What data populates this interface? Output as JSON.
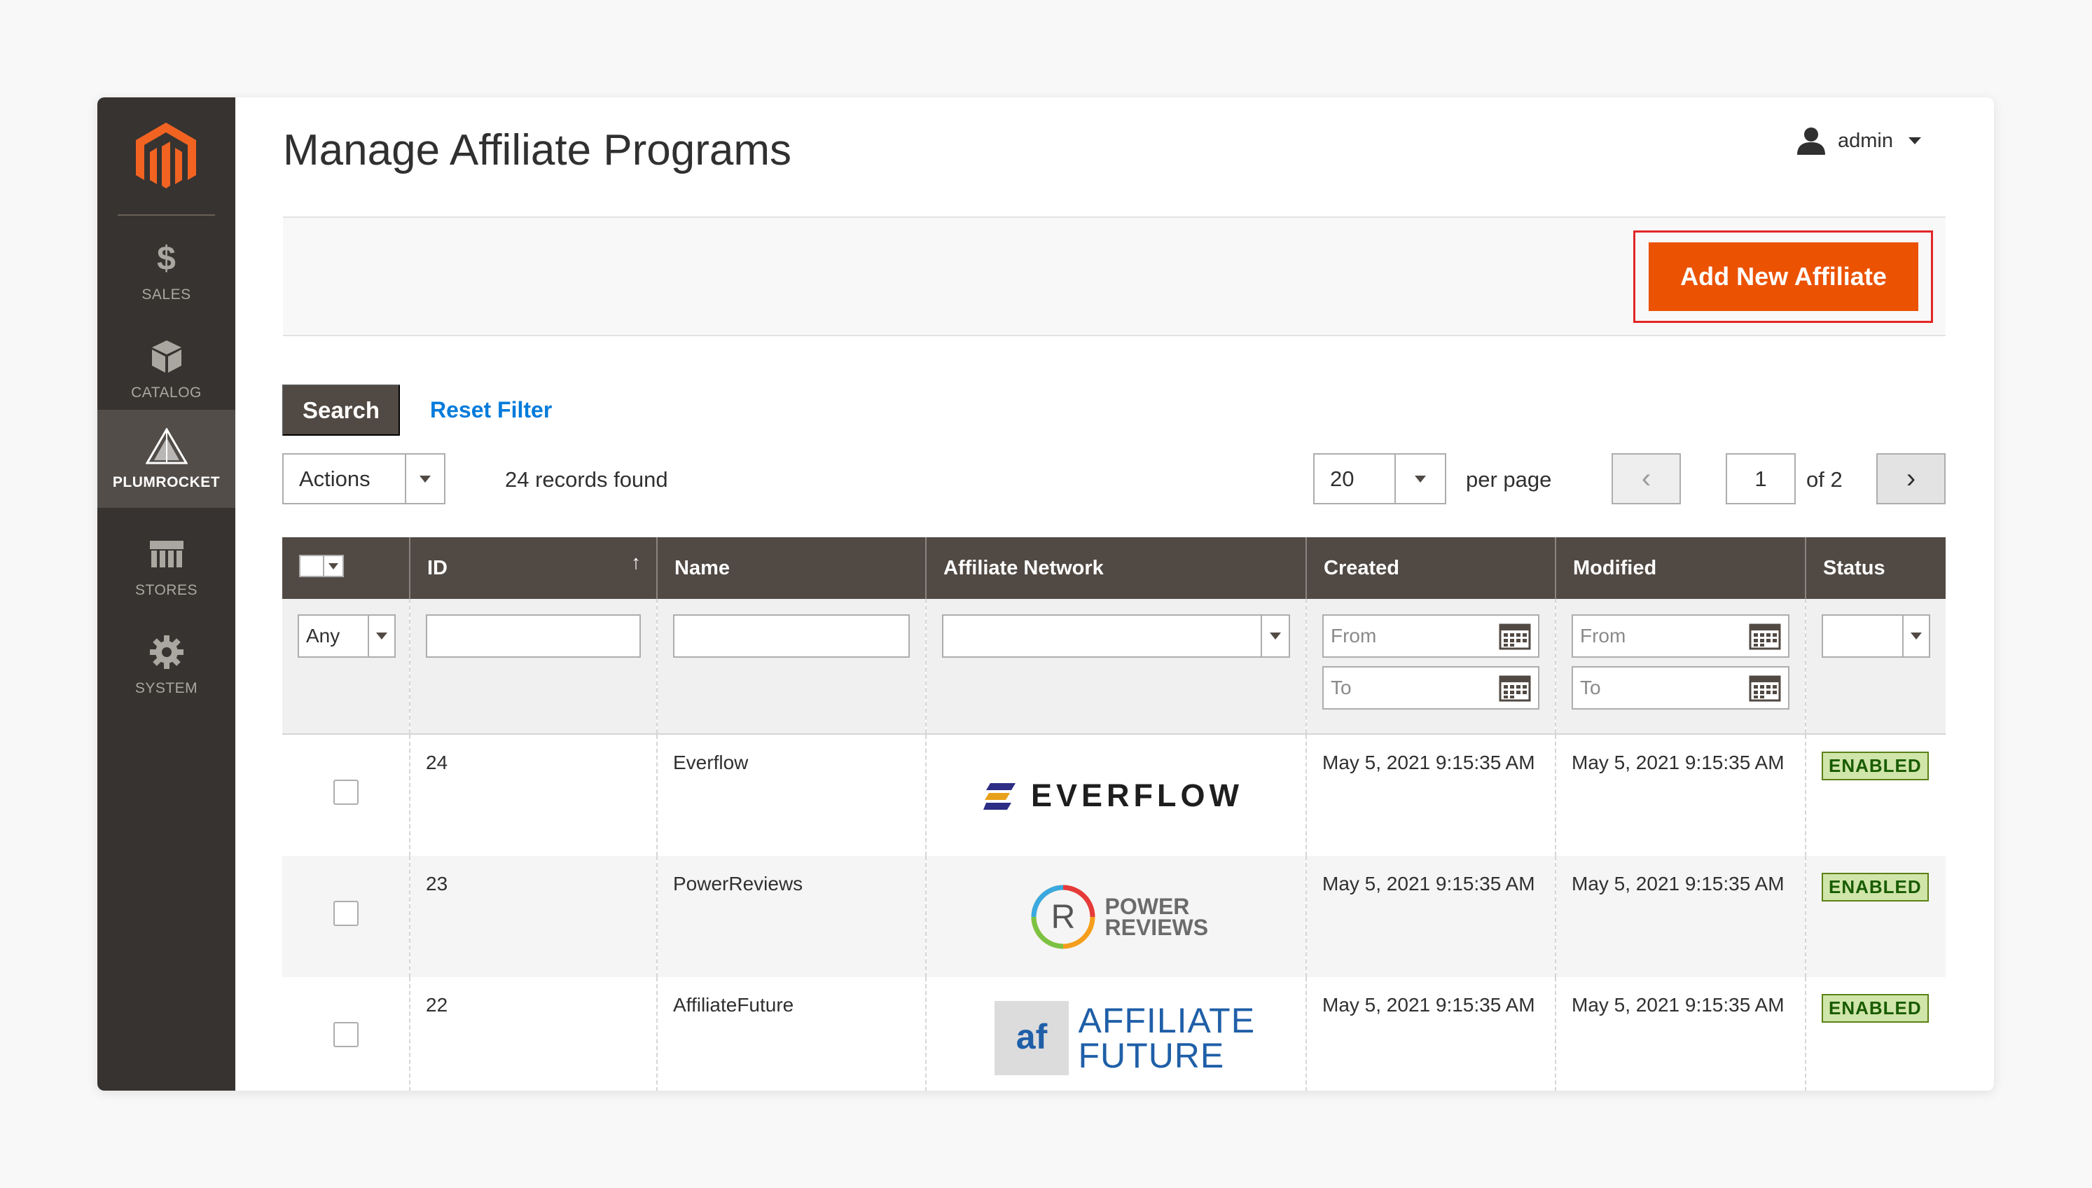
{
  "sidebar": {
    "items": [
      {
        "label": "SALES",
        "icon": "dollar-icon"
      },
      {
        "label": "CATALOG",
        "icon": "box-icon"
      },
      {
        "label": "PLUMROCKET",
        "icon": "plumrocket-icon",
        "active": true
      },
      {
        "label": "STORES",
        "icon": "store-icon"
      },
      {
        "label": "SYSTEM",
        "icon": "gear-icon"
      }
    ]
  },
  "header": {
    "title": "Manage Affiliate Programs",
    "user": "admin"
  },
  "toolbar": {
    "add_label": "Add New Affiliate",
    "search_label": "Search",
    "reset_label": "Reset Filter",
    "actions_label": "Actions",
    "records_text": "24 records found",
    "per_page_value": "20",
    "per_page_label": "per page",
    "current_page": "1",
    "total_pages_text": "of 2"
  },
  "grid": {
    "columns": [
      "ID",
      "Name",
      "Affiliate Network",
      "Created",
      "Modified",
      "Status"
    ],
    "filters": {
      "massaction_value": "Any",
      "date_from_placeholder": "From",
      "date_to_placeholder": "To"
    },
    "rows": [
      {
        "id": "24",
        "name": "Everflow",
        "network_logo": "EVERFLOW",
        "created": "May 5, 2021 9:15:35 AM",
        "modified": "May 5, 2021 9:15:35 AM",
        "status": "ENABLED"
      },
      {
        "id": "23",
        "name": "PowerReviews",
        "network_logo": "POWER REVIEWS",
        "created": "May 5, 2021 9:15:35 AM",
        "modified": "May 5, 2021 9:15:35 AM",
        "status": "ENABLED"
      },
      {
        "id": "22",
        "name": "AffiliateFuture",
        "network_logo": "AFFILIATE FUTURE",
        "created": "May 5, 2021 9:15:35 AM",
        "modified": "May 5, 2021 9:15:35 AM",
        "status": "ENABLED"
      }
    ]
  },
  "colors": {
    "accent": "#eb5202",
    "sidebar_bg": "#373330",
    "header_bg": "#514943",
    "link": "#007bdb",
    "badge_bg": "#d0e5a9"
  }
}
